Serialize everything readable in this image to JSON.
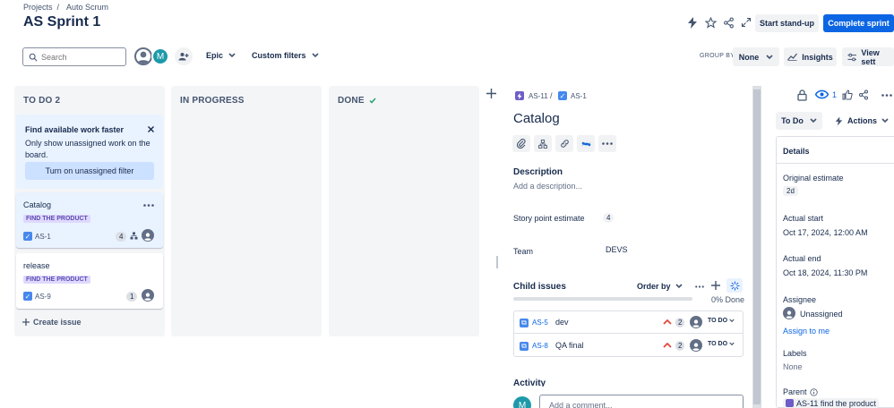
{
  "breadcrumb": {
    "projects": "Projects",
    "sep": "/",
    "project": "Auto Scrum"
  },
  "page_title": "AS Sprint 1",
  "header_buttons": {
    "standup": "Start stand-up",
    "complete": "Complete sprint"
  },
  "toolbar": {
    "search_placeholder": "Search",
    "avatar_initial": "M",
    "epic_label": "Epic",
    "custom_filters_label": "Custom filters",
    "group_by_label": "GROUP BY",
    "group_by_value": "None",
    "insights_label": "Insights",
    "view_settings_label": "View sett"
  },
  "columns": {
    "todo": "TO DO 2",
    "in_progress": "IN PROGRESS",
    "done": "DONE"
  },
  "tip": {
    "title": "Find available work faster",
    "body": "Only show unassigned work on the board.",
    "button": "Turn on unassigned filter"
  },
  "cards": [
    {
      "title": "Catalog",
      "epic": "FIND THE PRODUCT",
      "key": "AS-1",
      "points": "4"
    },
    {
      "title": "release",
      "epic": "FIND THE PRODUCT",
      "key": "AS-9",
      "points": "1"
    }
  ],
  "create_issue": "Create issue",
  "detail": {
    "parent_key": "AS-11",
    "sep": "/",
    "issue_key": "AS-1",
    "title": "Catalog",
    "description_label": "Description",
    "description_placeholder": "Add a description...",
    "story_points_label": "Story point estimate",
    "story_points_value": "4",
    "team_label": "Team",
    "team_value": "DEVS",
    "child_issues_label": "Child issues",
    "order_by_label": "Order by",
    "progress_text": "0% Done",
    "progress": 0,
    "children": [
      {
        "key": "AS-5",
        "summary": "dev",
        "points": "2",
        "status": "TO DO"
      },
      {
        "key": "AS-8",
        "summary": "QA final",
        "points": "2",
        "status": "TO DO"
      }
    ],
    "activity_label": "Activity",
    "comment_placeholder": "Add a comment...",
    "commenter_initial": "M"
  },
  "sidebar": {
    "watch_count": "1",
    "status_button": "To Do",
    "actions_button": "Actions",
    "details_label": "Details",
    "original_estimate_label": "Original estimate",
    "original_estimate_value": "2d",
    "actual_start_label": "Actual start",
    "actual_start_value": "Oct 17, 2024, 12:00 AM",
    "actual_end_label": "Actual end",
    "actual_end_value": "Oct 18, 2024, 11:30 PM",
    "assignee_label": "Assignee",
    "assignee_value": "Unassigned",
    "assign_to_me": "Assign to me",
    "labels_label": "Labels",
    "labels_value": "None",
    "parent_label": "Parent",
    "parent_value": "AS-11 find the product"
  },
  "colors": {
    "primary": "#0c66e4",
    "epic_purple": "#6e5dc6",
    "story_blue": "#4688ec",
    "priority_red": "#e2483d"
  }
}
